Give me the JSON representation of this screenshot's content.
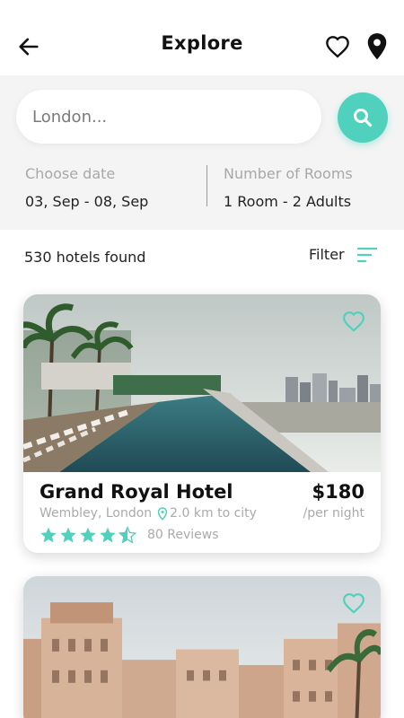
{
  "header": {
    "title": "Explore",
    "back_icon": "arrow-left-icon",
    "favorite_icon": "heart-icon",
    "location_icon": "map-pin-icon"
  },
  "search": {
    "placeholder": "London...",
    "button_icon": "search-icon"
  },
  "booking": {
    "date_label": "Choose date",
    "date_value": "03, Sep - 08, Sep",
    "rooms_label": "Number of Rooms",
    "rooms_value": "1 Room - 2 Adults"
  },
  "results": {
    "count_text": "530 hotels found",
    "filter_label": "Filter",
    "filter_icon": "filter-icon"
  },
  "hotels": [
    {
      "name": "Grand Royal Hotel",
      "price": "$180",
      "per_night": "/per night",
      "location": "Wembley, London",
      "distance": "2.0 km to city",
      "rating": 4.5,
      "reviews": "80 Reviews"
    },
    {
      "name": "",
      "price": "",
      "per_night": "",
      "location": "",
      "distance": "",
      "rating": null,
      "reviews": ""
    }
  ],
  "colors": {
    "accent": "#4fd1bd",
    "text": "#222222",
    "muted": "#aaaaaa"
  }
}
